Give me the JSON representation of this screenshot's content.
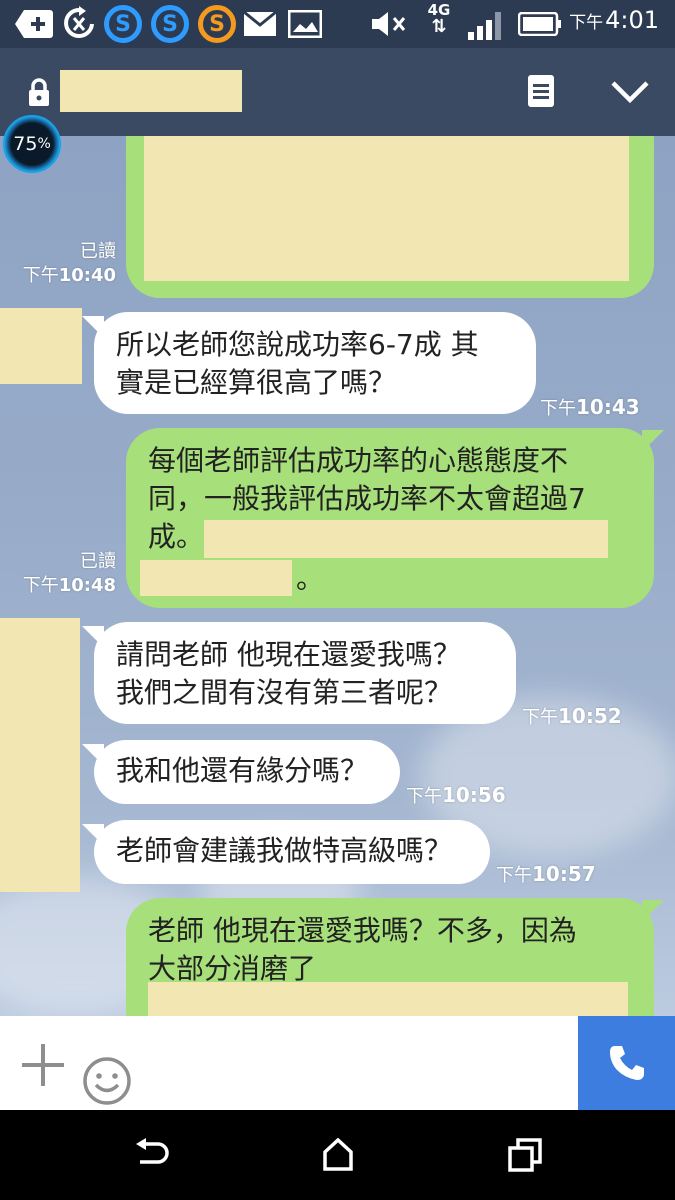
{
  "status_bar": {
    "time_period": "下午",
    "time": "4:01",
    "network": "4G",
    "icons": [
      "add-box-icon",
      "sync-icon",
      "s-app-icon-blue",
      "s-app-icon-blue",
      "s-app-icon-orange",
      "mail-icon",
      "image-icon",
      "mute-icon",
      "4g-icon",
      "signal-icon",
      "battery-icon"
    ]
  },
  "header": {
    "icons": [
      "lock-icon",
      "notes-icon",
      "chevron-down-icon"
    ]
  },
  "badge": {
    "value": "75",
    "unit": "%"
  },
  "messages": [
    {
      "side": "out",
      "read": "已讀",
      "period": "下午",
      "time": "10:40",
      "text": ""
    },
    {
      "side": "in",
      "line1": "所以老師您說成功率6-7成 其",
      "line2": "實是已經算很高了嗎？",
      "period": "下午",
      "time": "10:43"
    },
    {
      "side": "out",
      "line1": "每個老師評估成功率的心態態度不",
      "line2": "同，一般我評估成功率不太會超過7",
      "line3": "成。",
      "line4_tail": "。",
      "read": "已讀",
      "period": "下午",
      "time": "10:48"
    },
    {
      "side": "in",
      "line1": "請問老師  他現在還愛我嗎？",
      "line2": "我們之間有沒有第三者呢？",
      "period": "下午",
      "time": "10:52"
    },
    {
      "side": "in",
      "line1": "我和他還有緣分嗎？",
      "period": "下午",
      "time": "10:56"
    },
    {
      "side": "in",
      "line1": "老師會建議我做特高級嗎？",
      "period": "下午",
      "time": "10:57"
    },
    {
      "side": "out",
      "line1": "老師  他現在還愛我嗎？不多，因為",
      "line2": "大部分消磨了"
    }
  ],
  "colors": {
    "header": "#3a4a63",
    "status_bar": "#2d3b52",
    "bubble_out": "#a7e07a",
    "bubble_in": "#ffffff",
    "redaction": "#f2e6b3",
    "call_button": "#3d7de0"
  },
  "input_bar": {
    "icons": [
      "plus-icon",
      "emoji-icon",
      "phone-icon"
    ]
  },
  "nav_bar": {
    "icons": [
      "back-icon",
      "home-icon",
      "recents-icon"
    ]
  }
}
